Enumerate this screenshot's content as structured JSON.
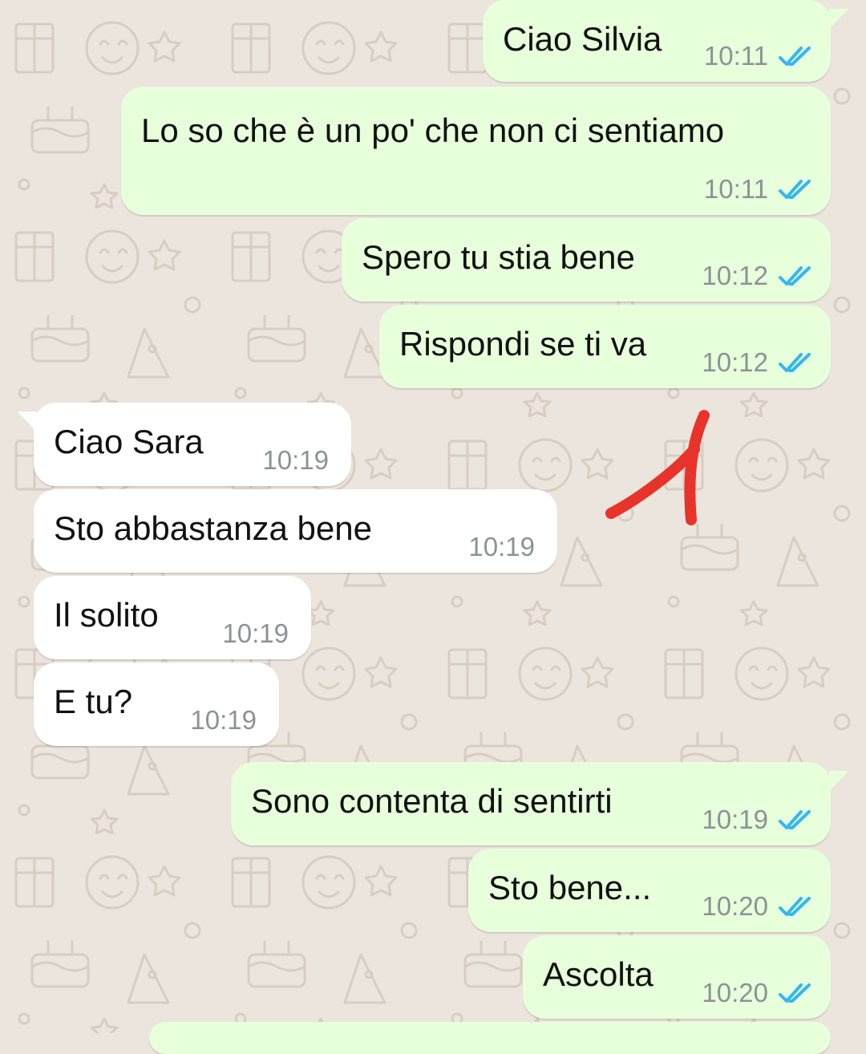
{
  "colors": {
    "background": "#ece5dd",
    "outgoing_bubble": "#e7ffdb",
    "incoming_bubble": "#ffffff",
    "read_ticks": "#34b7f1",
    "timestamp": "#8c9296",
    "annotation_mark": "#e8332a"
  },
  "messages": [
    {
      "direction": "outgoing",
      "text": "Ciao Silvia",
      "time": "10:11",
      "status_icon": "double-check-read-icon"
    },
    {
      "direction": "outgoing",
      "text": "Lo so che è un po' che non ci sentiamo",
      "time": "10:11",
      "status_icon": "double-check-read-icon"
    },
    {
      "direction": "outgoing",
      "text": "Spero tu stia bene",
      "time": "10:12",
      "status_icon": "double-check-read-icon"
    },
    {
      "direction": "outgoing",
      "text": "Rispondi se ti va",
      "time": "10:12",
      "status_icon": "double-check-read-icon"
    },
    {
      "direction": "incoming",
      "text": "Ciao Sara",
      "time": "10:19"
    },
    {
      "direction": "incoming",
      "text": "Sto abbastanza bene",
      "time": "10:19"
    },
    {
      "direction": "incoming",
      "text": "Il solito",
      "time": "10:19"
    },
    {
      "direction": "incoming",
      "text": "E tu?",
      "time": "10:19"
    },
    {
      "direction": "outgoing",
      "text": "Sono contenta di sentirti",
      "time": "10:19",
      "status_icon": "double-check-read-icon"
    },
    {
      "direction": "outgoing",
      "text": "Sto bene...",
      "time": "10:20",
      "status_icon": "double-check-read-icon"
    },
    {
      "direction": "outgoing",
      "text": "Ascolta",
      "time": "10:20",
      "status_icon": "double-check-read-icon"
    }
  ],
  "annotation": {
    "icon": "hand-drawn-number-one"
  }
}
